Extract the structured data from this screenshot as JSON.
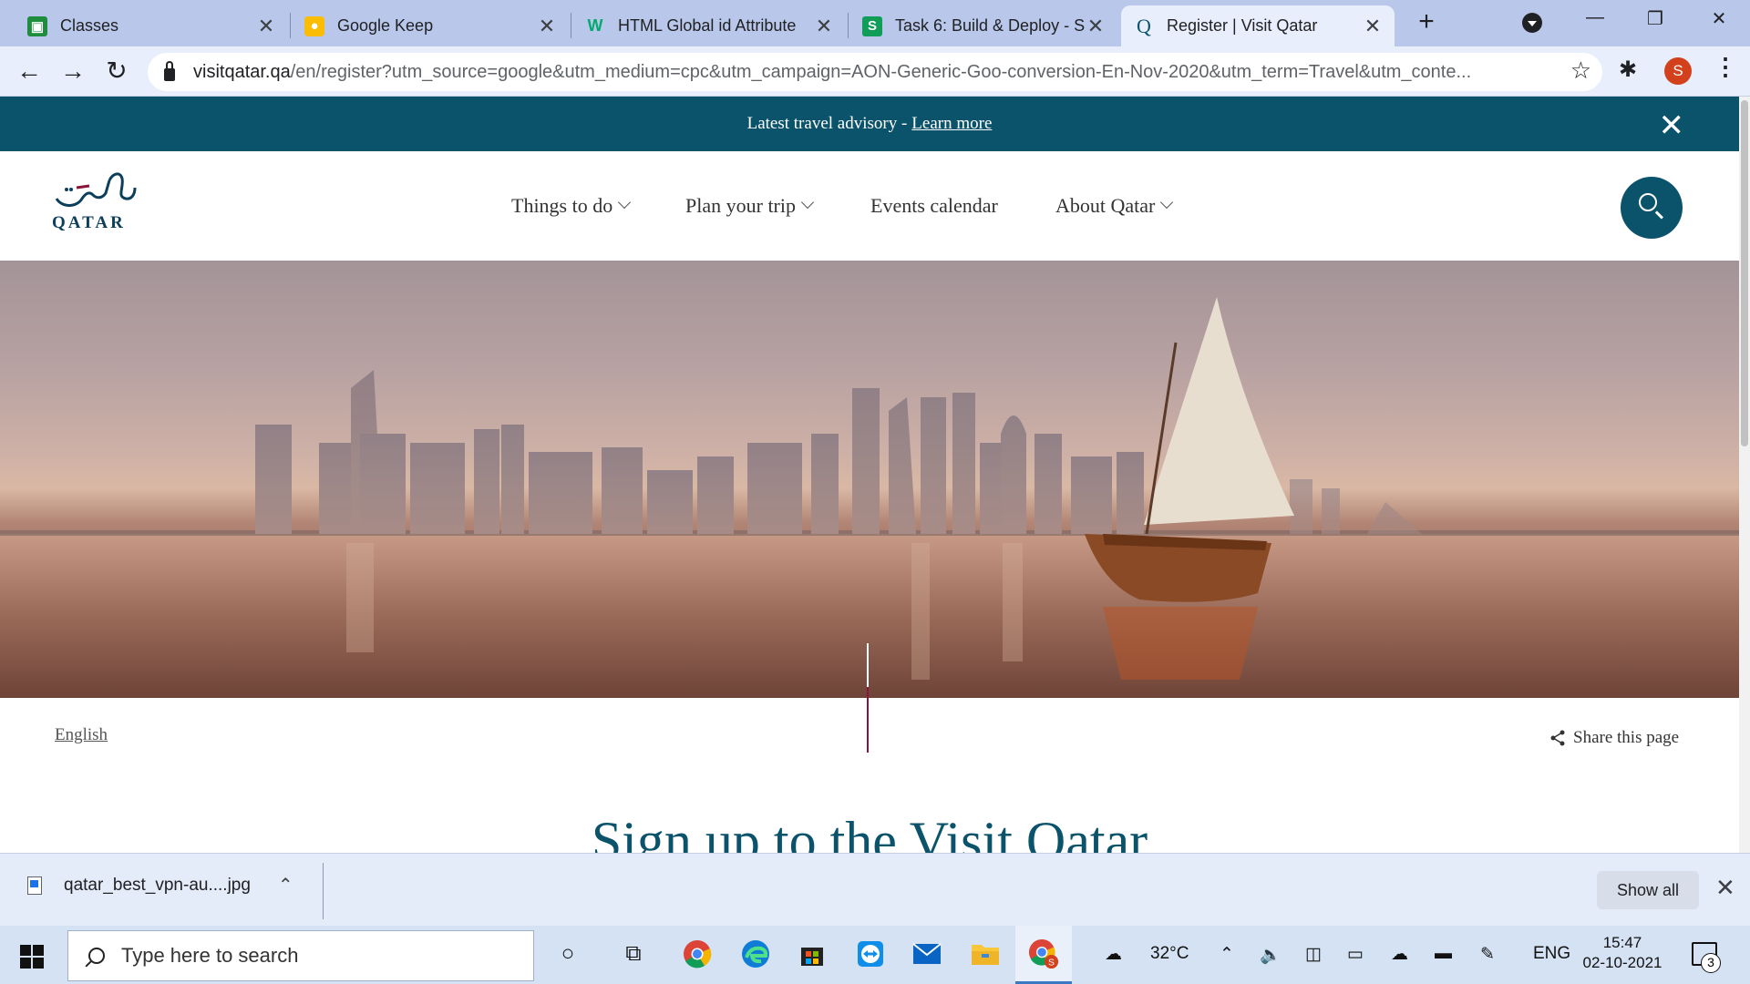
{
  "browser": {
    "tabs": [
      {
        "title": "Classes",
        "icon": "classroom-icon",
        "color": "#1e8e3e"
      },
      {
        "title": "Google Keep",
        "icon": "keep-icon",
        "color": "#fbbc04"
      },
      {
        "title": "HTML Global id Attribute",
        "icon": "w3schools-icon",
        "color": "#04aa6d"
      },
      {
        "title": "Task 6: Build & Deploy - S",
        "icon": "sheets-s-icon",
        "color": "#0f9d58"
      },
      {
        "title": "Register | Visit Qatar",
        "icon": "visitqatar-q-icon",
        "color": "#0b536b"
      }
    ],
    "url_host": "visitqatar.qa",
    "url_rest": "/en/register?utm_source=google&utm_medium=cpc&utm_campaign=AON-Generic-Goo-conversion-En-Nov-2020&utm_term=Travel&utm_conte...",
    "profile_initial": "S"
  },
  "advisory": {
    "text": "Latest travel advisory - ",
    "link": "Learn more"
  },
  "site": {
    "logo_word": "QATAR",
    "nav": [
      "Things to do",
      "Plan your trip",
      "Events calendar",
      "About Qatar"
    ],
    "language": "English",
    "share": "Share this page",
    "signup_title": "Sign up to the Visit Qatar"
  },
  "downloads": {
    "file": "qatar_best_vpn-au....jpg",
    "show_all": "Show all"
  },
  "taskbar": {
    "search_placeholder": "Type here to search",
    "weather": "32°C",
    "language": "ENG",
    "time": "15:47",
    "date": "02-10-2021",
    "notifications": "3"
  },
  "colors": {
    "brand_teal": "#0b536b",
    "maroon": "#8a1538"
  }
}
